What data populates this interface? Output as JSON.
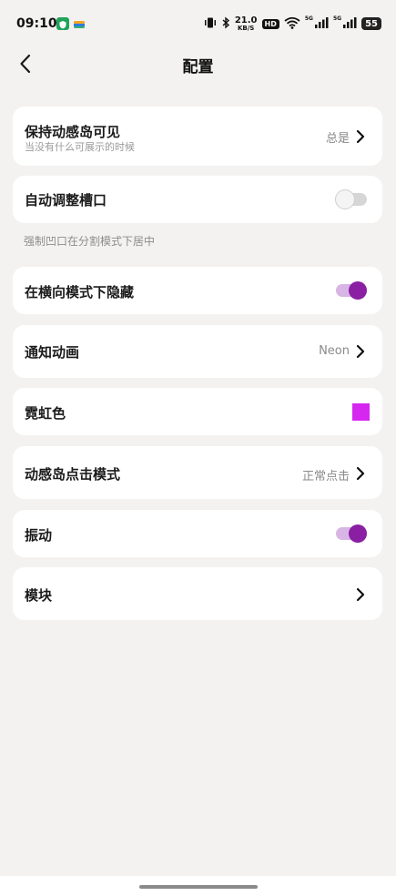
{
  "status_bar": {
    "time": "09:10",
    "net_speed_value": "21.0",
    "net_speed_unit": "KB/S",
    "hd_label": "HD",
    "net_label_1": "5G",
    "net_label_2": "5G",
    "battery": "55"
  },
  "nav": {
    "title": "配置"
  },
  "settings": {
    "always_show": {
      "title": "保持动感岛可见",
      "subtitle": "当没有什么可展示的时候",
      "value": "总是"
    },
    "auto_adjust": {
      "title": "自动调整槽口",
      "enabled": false
    },
    "auto_adjust_hint": "强制凹口在分割模式下居中",
    "hide_landscape": {
      "title": "在横向模式下隐藏",
      "enabled": true
    },
    "notification_anim": {
      "title": "通知动画",
      "value": "Neon"
    },
    "neon_color": {
      "title": "霓虹色",
      "color": "#d627f0"
    },
    "tap_mode": {
      "title": "动感岛点击模式",
      "value": "正常点击"
    },
    "vibration": {
      "title": "振动",
      "enabled": true
    },
    "modules": {
      "title": "模块"
    }
  },
  "colors": {
    "accent": "#8a1fa3",
    "accent_track": "#d7b5e4",
    "background": "#f4f2f1",
    "card": "#ffffff"
  },
  "icons": [
    "back-arrow-icon",
    "chevron-right-icon",
    "vibrate-icon",
    "bluetooth-icon",
    "wifi-icon",
    "signal-icon",
    "battery-icon"
  ]
}
